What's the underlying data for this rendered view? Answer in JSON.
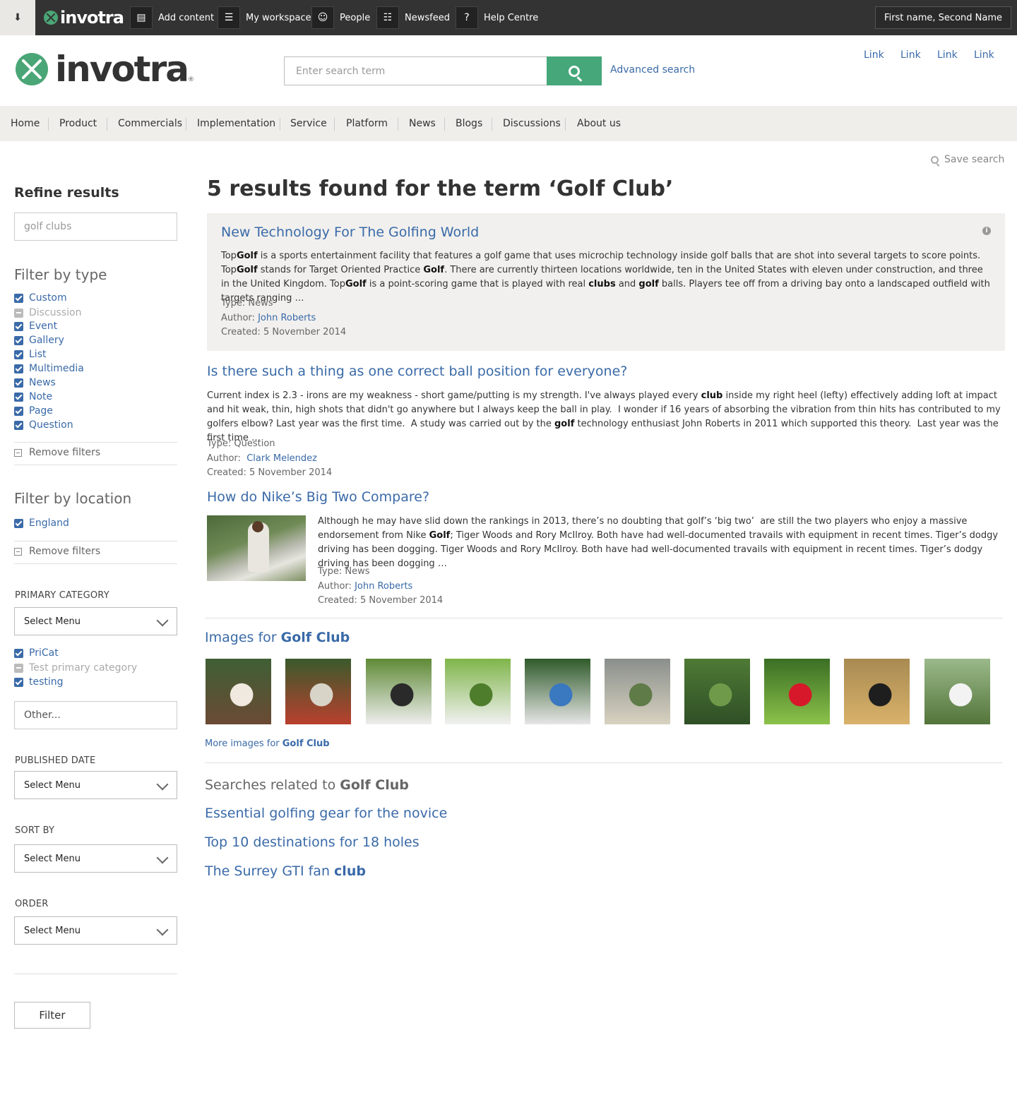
{
  "topbar": {
    "brand": "invotra",
    "items": [
      {
        "label": "Add content",
        "icon": "document-icon"
      },
      {
        "label": "My workspace",
        "icon": "list-icon"
      },
      {
        "label": "People",
        "icon": "people-icon"
      },
      {
        "label": "Newsfeed",
        "icon": "newspaper-icon"
      },
      {
        "label": "Help Centre",
        "icon": "help-icon"
      }
    ],
    "user": "First name, Second Name"
  },
  "header": {
    "logo_text": "invotra",
    "logo_reg": "®",
    "search_placeholder": "Enter search term",
    "advanced_search": "Advanced search",
    "links": [
      "Link",
      "Link",
      "Link",
      "Link"
    ]
  },
  "nav": [
    "Home",
    "Product",
    "Commercials",
    "Implementation",
    "Service",
    "Platform",
    "News",
    "Blogs",
    "Discussions",
    "About us"
  ],
  "save_search": "Save search",
  "sidebar": {
    "refine_title": "Refine results",
    "refine_value": "golf clubs",
    "filter_type_title": "Filter by type",
    "types": [
      {
        "label": "Custom",
        "state": "checked"
      },
      {
        "label": "Discussion",
        "state": "partial"
      },
      {
        "label": "Event",
        "state": "checked"
      },
      {
        "label": "Gallery",
        "state": "checked"
      },
      {
        "label": "List",
        "state": "checked"
      },
      {
        "label": "Multimedia",
        "state": "checked"
      },
      {
        "label": "News",
        "state": "checked"
      },
      {
        "label": "Note",
        "state": "checked"
      },
      {
        "label": "Page",
        "state": "checked"
      },
      {
        "label": "Question",
        "state": "checked"
      }
    ],
    "remove_filters": "Remove filters",
    "filter_location_title": "Filter by location",
    "locations": [
      {
        "label": "England",
        "state": "checked"
      }
    ],
    "primary_category_label": "PRIMARY CATEGORY",
    "select_menu": "Select Menu",
    "categories": [
      {
        "label": "PriCat",
        "state": "checked"
      },
      {
        "label": "Test primary category",
        "state": "partial"
      },
      {
        "label": "testing",
        "state": "checked"
      }
    ],
    "other_placeholder": "Other...",
    "published_date_label": "PUBLISHED DATE",
    "sort_by_label": "SORT BY",
    "order_label": "ORDER",
    "filter_button": "Filter"
  },
  "main": {
    "title": "5 results found for the term ‘Golf Club’",
    "results": [
      {
        "title": "New Technology For The Golfing World",
        "snippet_html": "Top<b>Golf</b> is a sports entertainment facility that features a golf game that uses microchip technology inside golf balls that are shot into several targets to score points. Top<b>Golf</b> stands for Target Oriented Practice <b>Golf</b>. There are currently thirteen locations worldwide, ten in the United States with eleven under construction, and three in the United Kingdom. Top<b>Golf</b> is a point-scoring game that is played with real <b>clubs</b> and <b>golf</b> balls. Players tee off from a driving bay onto a landscaped outfield with targets ranging …",
        "type": "Type: News",
        "author_label": "Author:",
        "author": "John Roberts",
        "created": "Created: 5 November 2014"
      },
      {
        "title": "Is there such a thing as one correct ball position for everyone?",
        "snippet_html": "Current index is 2.3 - irons are my weakness - short game/putting is my strength. I've always played every <b>club</b> inside my right heel (lefty) effectively adding loft at impact and hit weak, thin, high shots that didn't go anywhere but I always keep the ball in play.&nbsp; I wonder if 16 years of absorbing the vibration from thin hits has contributed to my golfers elbow? Last year was the first time.&nbsp; A study was carried out by the <b>golf</b> technology enthusiast John Roberts in 2011 which supported this theory.&nbsp; Last year was the first time …",
        "type": "Type: Question",
        "author_label": "Author:",
        "author": "Clark Melendez",
        "created": "Created: 5 November 2014"
      },
      {
        "title": "How do Nike’s Big Two Compare?",
        "snippet_html": "Although he may have slid down the rankings in 2013, there’s no doubting that golf’s ‘big two’&nbsp; are still the two players who enjoy a massive endorsement from Nike <b>Golf</b>; Tiger Woods and Rory McIlroy. Both have had well-documented travails with equipment in recent times. Tiger’s dodgy driving has been dogging. Tiger Woods and Rory McIlroy. Both have had well-documented travails with equipment in recent times. Tiger’s dodgy driving has been dogging …",
        "type": "Type: News",
        "author_label": "Author:",
        "author": "John Roberts",
        "created": "Created: 5 November 2014"
      }
    ],
    "images_prefix": "Images for ",
    "images_term": "Golf Club",
    "images": [
      {
        "name": "golfer-portrait",
        "colors": [
          "#3f5f35",
          "#efe9df",
          "#6b4a34"
        ]
      },
      {
        "name": "golf-bag-clubs",
        "colors": [
          "#3a5a2c",
          "#d9d4c8",
          "#b9402e"
        ]
      },
      {
        "name": "driver-and-ball",
        "colors": [
          "#5f8a35",
          "#2a2a2a",
          "#eeeeee"
        ]
      },
      {
        "name": "iron-and-ball",
        "colors": [
          "#7fb54a",
          "#4e7d2b",
          "#f1f1f1"
        ]
      },
      {
        "name": "club-on-tee",
        "colors": [
          "#2f5a2a",
          "#3a78c0",
          "#e6e6e6"
        ]
      },
      {
        "name": "mountain-course",
        "colors": [
          "#8a8f8c",
          "#5f7b48",
          "#d8d2c0"
        ]
      },
      {
        "name": "green-course",
        "colors": [
          "#4e7a35",
          "#6f9a4a",
          "#2f4f26"
        ]
      },
      {
        "name": "red-golf-ball",
        "colors": [
          "#3a6e24",
          "#d6182a",
          "#8cc24a"
        ]
      },
      {
        "name": "golfer-sunset",
        "colors": [
          "#a88a52",
          "#1e1e1e",
          "#d9b26a"
        ]
      },
      {
        "name": "woman-golfer",
        "colors": [
          "#9bb98a",
          "#f3f3f3",
          "#53753a"
        ]
      }
    ],
    "more_images_prefix": "More images for ",
    "more_images_term": "Golf Club",
    "related_prefix": "Searches related to ",
    "related_term": "Golf Club",
    "related": [
      {
        "text": "Essential golfing gear for the novice",
        "bold": ""
      },
      {
        "text": "Top 10 destinations for 18 holes",
        "bold": ""
      },
      {
        "text": "The Surrey GTI fan ",
        "bold": "club"
      }
    ]
  }
}
